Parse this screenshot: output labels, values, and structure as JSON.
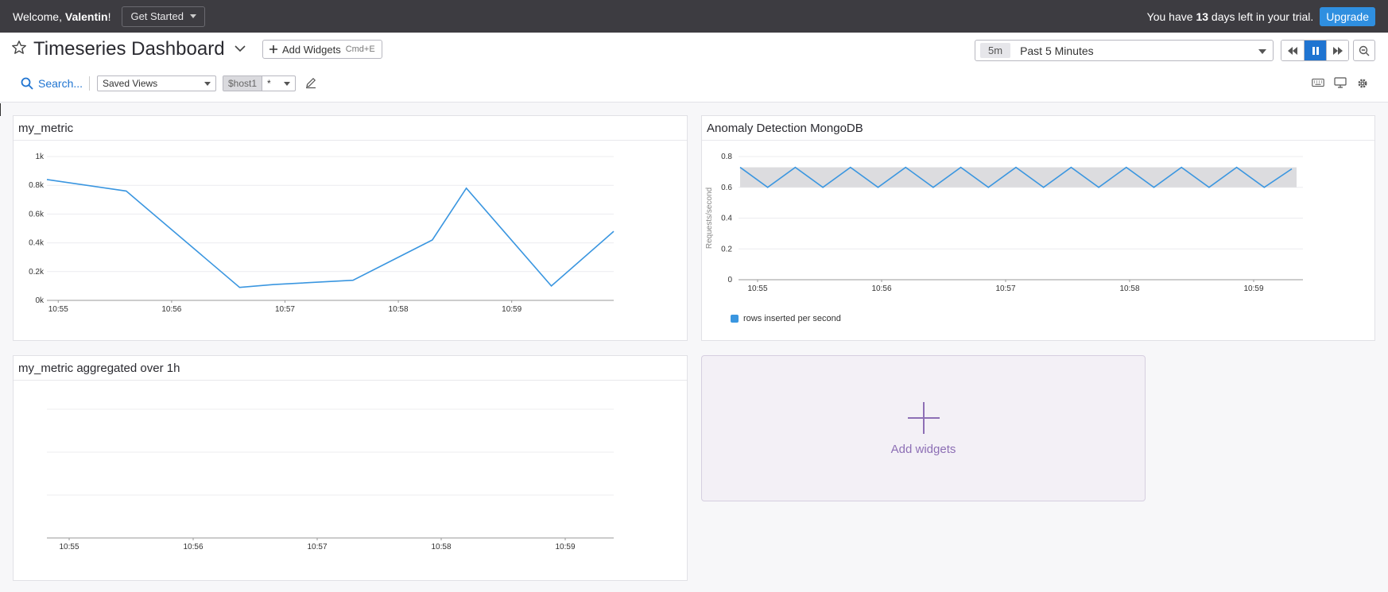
{
  "topbar": {
    "welcome_prefix": "Welcome, ",
    "user": "Valentin",
    "welcome_suffix": "!",
    "get_started": "Get Started",
    "trial_prefix": "You have ",
    "trial_days": "13",
    "trial_suffix": " days left in your trial.",
    "upgrade": "Upgrade"
  },
  "header": {
    "title": "Timeseries Dashboard",
    "add_widgets": "Add Widgets",
    "add_widgets_kbd": "Cmd+E",
    "time_chip": "5m",
    "time_label": "Past 5 Minutes",
    "search": "Search...",
    "saved_views": "Saved Views",
    "template_var_name": "$host1",
    "template_var_value": "*"
  },
  "colors": {
    "accent": "#1f74d1",
    "series": "#3a96e0",
    "band": "#dcdcdf",
    "add_widget": "#8d6fb5"
  },
  "icons": [
    "star-icon",
    "chevron-down-icon",
    "plus-icon",
    "rewind-icon",
    "pause-icon",
    "fast-forward-icon",
    "zoom-out-icon",
    "search-icon",
    "pencil-icon",
    "keyboard-icon",
    "monitor-icon",
    "gear-icon"
  ],
  "widgets": {
    "w1": {
      "title": "my_metric"
    },
    "w2": {
      "title": "Anomaly Detection MongoDB",
      "legend": "rows inserted per second",
      "ylabel": "Requests/second"
    },
    "w3": {
      "title": "my_metric aggregated over 1h"
    },
    "add": {
      "label": "Add widgets"
    }
  },
  "chart_data": [
    {
      "type": "line",
      "title": "my_metric",
      "x_ticks": [
        "10:55",
        "10:56",
        "10:57",
        "10:58",
        "10:59"
      ],
      "y_ticks": [
        "0k",
        "0.2k",
        "0.4k",
        "0.6k",
        "0.8k",
        "1k"
      ],
      "ylim": [
        0,
        1000
      ],
      "xlim": [
        10.9,
        15.9
      ],
      "series": [
        {
          "x": [
            10.9,
            11.6,
            12.6,
            12.9,
            13.6,
            14.3,
            14.6,
            15.35,
            15.95
          ],
          "values": [
            840,
            760,
            90,
            110,
            140,
            420,
            780,
            100,
            480
          ]
        }
      ]
    },
    {
      "type": "line",
      "title": "Anomaly Detection MongoDB",
      "ylabel": "Requests/second",
      "x_ticks": [
        "10:55",
        "10:56",
        "10:57",
        "10:58",
        "10:59"
      ],
      "y_ticks": [
        "0",
        "0.2",
        "0.4",
        "0.6",
        "0.8"
      ],
      "ylim": [
        0,
        0.8
      ],
      "band": [
        0.6,
        0.73
      ],
      "series": [
        {
          "name": "rows inserted per second",
          "x": [
            0,
            1,
            2,
            3,
            4,
            5,
            6,
            7,
            8,
            9,
            10,
            11,
            12,
            13,
            14,
            15,
            16,
            17,
            18,
            19,
            20
          ],
          "values": [
            0.73,
            0.6,
            0.73,
            0.6,
            0.73,
            0.6,
            0.73,
            0.6,
            0.73,
            0.6,
            0.73,
            0.6,
            0.73,
            0.6,
            0.73,
            0.6,
            0.73,
            0.6,
            0.73,
            0.6,
            0.72
          ]
        }
      ]
    },
    {
      "type": "line",
      "title": "my_metric aggregated over 1h",
      "x_ticks": [
        "10:55",
        "10:56",
        "10:57",
        "10:58",
        "10:59"
      ],
      "series": []
    }
  ]
}
